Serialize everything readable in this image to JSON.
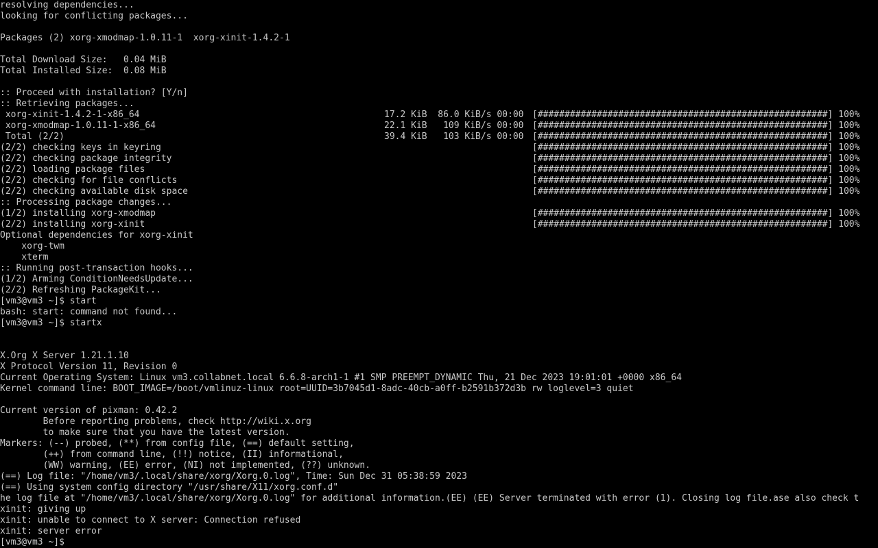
{
  "theme": {
    "background": "#000000",
    "foreground": "#c8c8c8"
  },
  "terminal": {
    "lines": [
      "resolving dependencies...",
      "looking for conflicting packages...",
      "",
      "Packages (2) xorg-xmodmap-1.0.11-1  xorg-xinit-1.4.2-1",
      "",
      "Total Download Size:   0.04 MiB",
      "Total Installed Size:  0.08 MiB",
      "",
      ":: Proceed with installation? [Y/n]",
      ":: Retrieving packages...",
      {
        "left": " xorg-xinit-1.4.2-1-x86_64",
        "stats": "17.2 KiB  86.0 KiB/s 00:00",
        "bar": "[######################################################] 100%"
      },
      {
        "left": " xorg-xmodmap-1.0.11-1-x86_64",
        "stats": "22.1 KiB   109 KiB/s 00:00",
        "bar": "[######################################################] 100%"
      },
      {
        "left": " Total (2/2)",
        "stats": "39.4 KiB   103 KiB/s 00:00",
        "bar": "[######################################################] 100%"
      },
      {
        "left": "(2/2) checking keys in keyring",
        "bar": "[######################################################] 100%"
      },
      {
        "left": "(2/2) checking package integrity",
        "bar": "[######################################################] 100%"
      },
      {
        "left": "(2/2) loading package files",
        "bar": "[######################################################] 100%"
      },
      {
        "left": "(2/2) checking for file conflicts",
        "bar": "[######################################################] 100%"
      },
      {
        "left": "(2/2) checking available disk space",
        "bar": "[######################################################] 100%"
      },
      ":: Processing package changes...",
      {
        "left": "(1/2) installing xorg-xmodmap",
        "bar": "[######################################################] 100%"
      },
      {
        "left": "(2/2) installing xorg-xinit",
        "bar": "[######################################################] 100%"
      },
      "Optional dependencies for xorg-xinit",
      "    xorg-twm",
      "    xterm",
      ":: Running post-transaction hooks...",
      "(1/2) Arming ConditionNeedsUpdate...",
      "(2/2) Refreshing PackageKit...",
      "[vm3@vm3 ~]$ start",
      "bash: start: command not found...",
      "[vm3@vm3 ~]$ startx",
      "",
      "",
      "X.Org X Server 1.21.1.10",
      "X Protocol Version 11, Revision 0",
      "Current Operating System: Linux vm3.collabnet.local 6.6.8-arch1-1 #1 SMP PREEMPT_DYNAMIC Thu, 21 Dec 2023 19:01:01 +0000 x86_64",
      "Kernel command line: BOOT_IMAGE=/boot/vmlinuz-linux root=UUID=3b7045d1-8adc-40cb-a0ff-b2591b372d3b rw loglevel=3 quiet",
      "",
      "Current version of pixman: 0.42.2",
      "        Before reporting problems, check http://wiki.x.org",
      "        to make sure that you have the latest version.",
      "Markers: (--) probed, (**) from config file, (==) default setting,",
      "        (++) from command line, (!!) notice, (II) informational,",
      "        (WW) warning, (EE) error, (NI) not implemented, (??) unknown.",
      "(==) Log file: \"/home/vm3/.local/share/xorg/Xorg.0.log\", Time: Sun Dec 31 05:38:59 2023",
      "(==) Using system config directory \"/usr/share/X11/xorg.conf.d\"",
      "he log file at \"/home/vm3/.local/share/xorg/Xorg.0.log\" for additional information.(EE) (EE) Server terminated with error (1). Closing log file.ase also check t",
      "xinit: giving up",
      "xinit: unable to connect to X server: Connection refused",
      "xinit: server error",
      "[vm3@vm3 ~]$ "
    ]
  }
}
